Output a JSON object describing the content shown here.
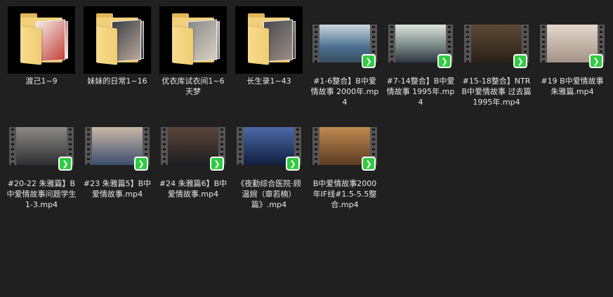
{
  "items": [
    {
      "name": "渡己1~9",
      "type": "folder",
      "colors": [
        "#f1ece6",
        "#c6423c"
      ]
    },
    {
      "name": "妹妹的日常1~16",
      "type": "folder",
      "colors": [
        "#3a3e46",
        "#b9a99a"
      ]
    },
    {
      "name": "优衣库试衣间1~6天梦",
      "type": "folder",
      "colors": [
        "#8a8b88",
        "#d8cfc2"
      ]
    },
    {
      "name": "长生录1~43",
      "type": "folder",
      "colors": [
        "#4a4c52",
        "#9a8c84"
      ]
    },
    {
      "name": "#1-6整合】B中爱情故事 2000年.mp4",
      "type": "video",
      "colors": [
        "#4a6f8e",
        "#cdd7df"
      ]
    },
    {
      "name": "#7-14整合】B中爱情故事 1995年.mp4",
      "type": "video",
      "colors": [
        "#7b8a86",
        "#dfe3df"
      ]
    },
    {
      "name": "#15-18整合】NTR B中爱情故事 过去篇1995年.mp4",
      "type": "video",
      "colors": [
        "#2a2118",
        "#5c4a36"
      ]
    },
    {
      "name": "#19 B中爱情故事朱雅篇.mp4",
      "type": "video",
      "colors": [
        "#a39285",
        "#e4d8cc"
      ]
    },
    {
      "name": "#20-22 朱雅篇】B中爱情故事问题学生1-3.mp4",
      "type": "video",
      "colors": [
        "#2f2f32",
        "#8b8a86"
      ]
    },
    {
      "name": "#23 朱雅篇5】B中爱情故事.mp4",
      "type": "video",
      "colors": [
        "#3c4e6e",
        "#c9b8a6"
      ]
    },
    {
      "name": "#24 朱雅篇6】B中爱情故事.mp4",
      "type": "video",
      "colors": [
        "#1e1e22",
        "#5a463a"
      ]
    },
    {
      "name": "《夜勤综合医院·顾温婉（章若楠）篇》.mp4",
      "type": "video",
      "colors": [
        "#0f1e3d",
        "#4d6aa8"
      ]
    },
    {
      "name": "B中爱情故事2000年IF线#1.5-5.5整合.mp4",
      "type": "video",
      "colors": [
        "#5a3b22",
        "#c08a52"
      ]
    }
  ],
  "badge_color": "#2ecc40",
  "badge_icon": "stream-icon"
}
